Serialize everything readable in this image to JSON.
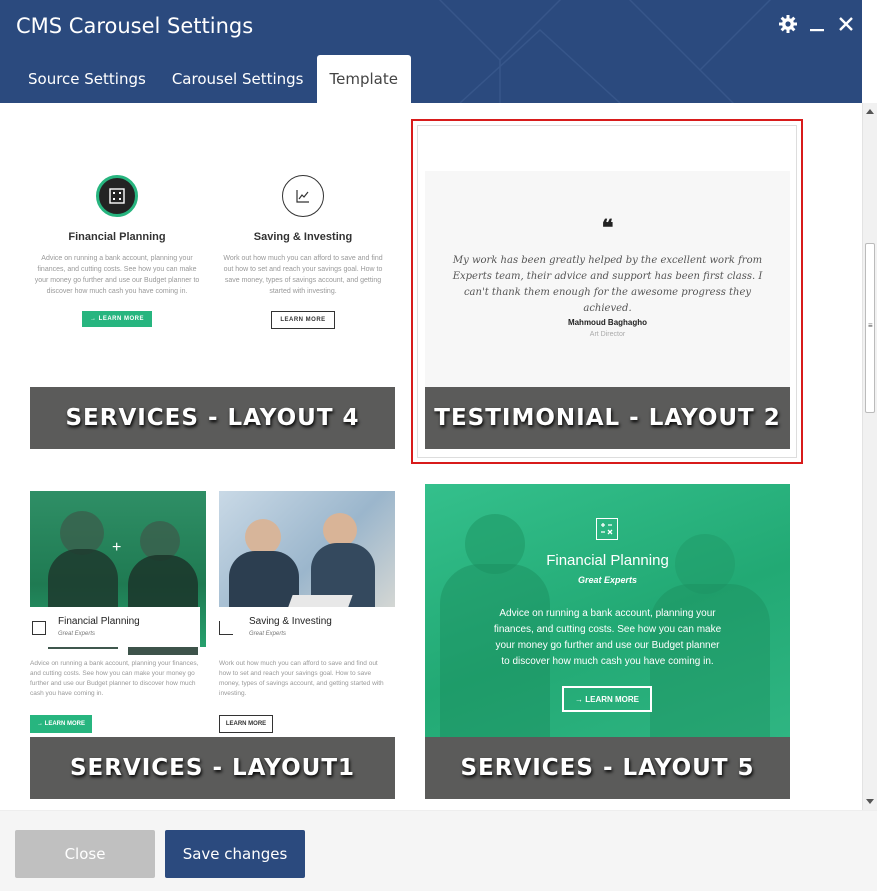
{
  "window": {
    "title": "CMS Carousel Settings",
    "icons": [
      "gear-icon",
      "minimize-icon",
      "close-icon"
    ]
  },
  "tabs": [
    {
      "label": "Source Settings",
      "active": false
    },
    {
      "label": "Carousel Settings",
      "active": false
    },
    {
      "label": "Template",
      "active": true
    }
  ],
  "templates": [
    {
      "name": "SERVICES - LAYOUT 4",
      "selected": false,
      "preview": {
        "col1": {
          "icon": "calculator-icon",
          "title": "Financial Planning",
          "text": "Advice on running a bank account, planning your finances, and cutting costs. See how you can make your money go further and use our Budget planner to discover how much cash you have coming in.",
          "button": "→ LEARN MORE"
        },
        "col2": {
          "icon": "chart-icon",
          "title": "Saving & Investing",
          "text": "Work out how much you can afford to save and find out how to set and reach your savings goal. How to save money, types of savings account, and getting started with investing.",
          "button": "LEARN MORE"
        }
      }
    },
    {
      "name": "TESTIMONIAL - LAYOUT 2",
      "selected": true,
      "preview": {
        "quote": "My work has been greatly helped by the excellent work from Experts team, their advice and support has been first class. I can't thank them enough for the awesome progress they achieved.",
        "author": "Mahmoud Baghagho",
        "role": "Art Director"
      }
    },
    {
      "name": "SERVICES - LAYOUT1",
      "selected": false,
      "preview": {
        "col1": {
          "title": "Financial Planning",
          "subtitle": "Great Experts",
          "text": "Advice on running a bank account, planning your finances, and cutting costs. See how you can make your money go further and use our Budget planner to discover how much cash you have coming in.",
          "button": "→ LEARN MORE"
        },
        "col2": {
          "title": "Saving & Investing",
          "subtitle": "Great Experts",
          "text": "Work out how much you can afford to save and find out how to set and reach your savings goal. How to save money, types of savings account, and getting started with investing.",
          "button": "LEARN MORE"
        }
      }
    },
    {
      "name": "SERVICES - LAYOUT 5",
      "selected": false,
      "preview": {
        "title": "Financial Planning",
        "subtitle": "Great Experts",
        "text": "Advice on running a bank account, planning your finances, and cutting costs. See how you can make your money go further and use our Budget planner to discover how much cash you have coming in.",
        "button": "→ LEARN MORE"
      }
    }
  ],
  "footer": {
    "close_label": "Close",
    "save_label": "Save changes"
  },
  "colors": {
    "header": "#2b4a7e",
    "accent_green": "#27b57f",
    "banner": "#5b5b5a",
    "selection": "#d81b1b"
  }
}
